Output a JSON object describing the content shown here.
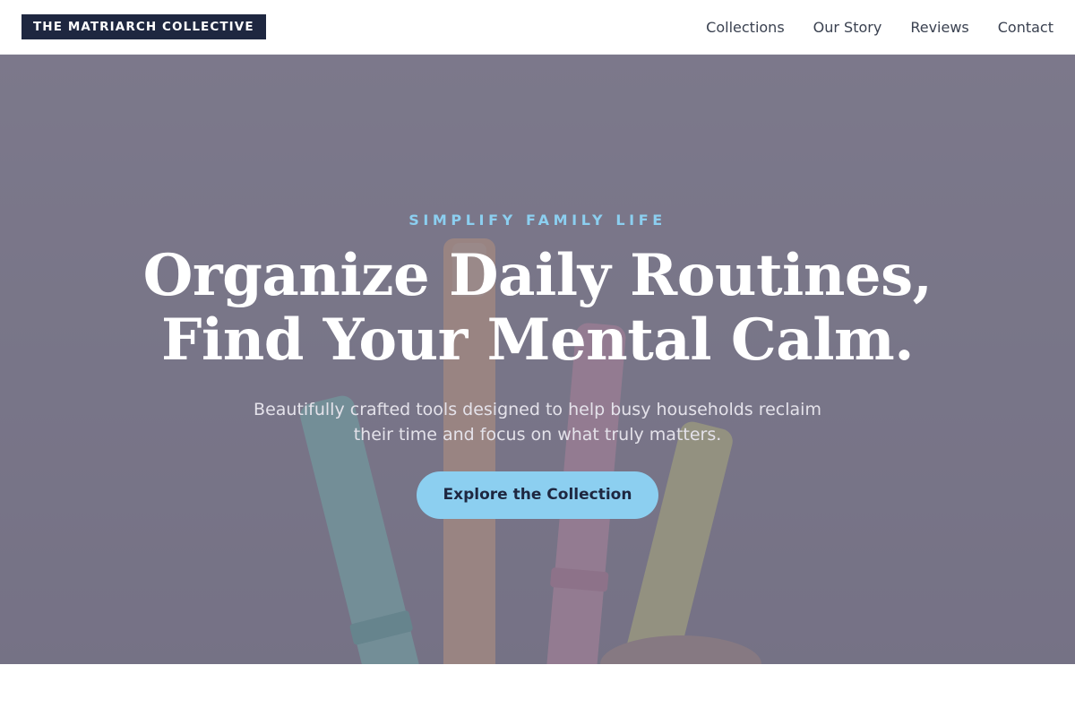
{
  "header": {
    "brand": "THE MATRIARCH COLLECTIVE",
    "nav": [
      {
        "label": "Collections"
      },
      {
        "label": "Our Story"
      },
      {
        "label": "Reviews"
      },
      {
        "label": "Contact"
      }
    ]
  },
  "hero": {
    "eyebrow": "SIMPLIFY FAMILY LIFE",
    "headline_line1": "Organize Daily Routines,",
    "headline_line2": "Find Your Mental Calm.",
    "subtitle_line1": "Beautifully crafted tools designed to help busy households reclaim",
    "subtitle_line2": "their time and focus on what truly matters.",
    "cta_label": "Explore the Collection",
    "background_image": "pastel-markers-photo"
  },
  "colors": {
    "brand_navy": "#1e2740",
    "accent_sky": "#8ccff0",
    "overlay": "#4e4a62"
  }
}
